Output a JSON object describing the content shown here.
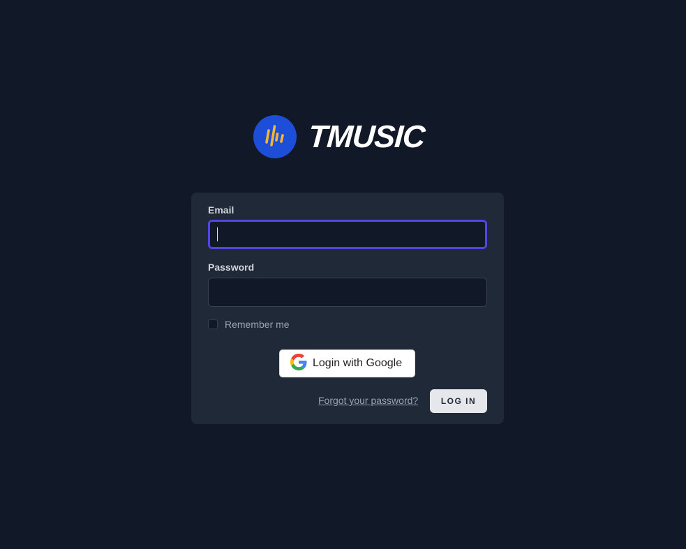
{
  "brand": {
    "name": "TMUSIC",
    "logo_icon": "soundwave-icon",
    "logo_bg_color": "#1d4ed8",
    "logo_wave_color": "#f2b632"
  },
  "login_form": {
    "email_label": "Email",
    "email_value": "",
    "password_label": "Password",
    "password_value": "",
    "remember_label": "Remember me",
    "remember_checked": false,
    "google_button_label": "Login with Google",
    "forgot_password_label": "Forgot your password?",
    "login_button_label": "LOG IN"
  },
  "colors": {
    "background": "#111827",
    "card": "#1f2937",
    "focus_ring": "#4f46e5"
  }
}
